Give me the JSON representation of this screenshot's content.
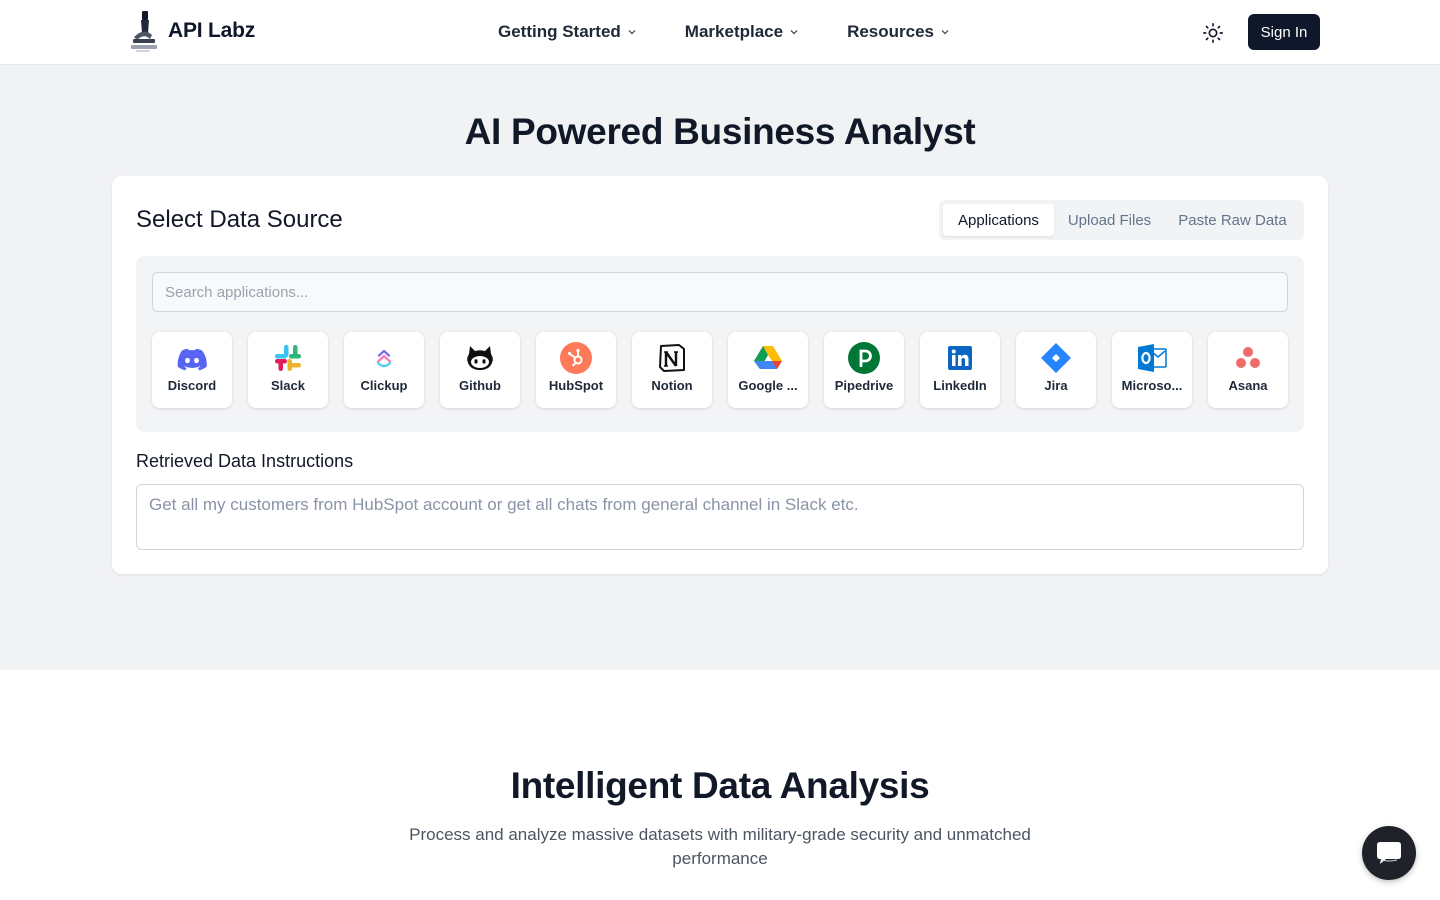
{
  "header": {
    "brand": "API Labz",
    "nav": [
      {
        "label": "Getting Started"
      },
      {
        "label": "Marketplace"
      },
      {
        "label": "Resources"
      }
    ],
    "theme_icon": "sun-icon",
    "sign_in": "Sign In"
  },
  "hero": {
    "title": "AI Powered Business Analyst",
    "card": {
      "title": "Select Data Source",
      "tabs": [
        {
          "label": "Applications",
          "active": true
        },
        {
          "label": "Upload Files",
          "active": false
        },
        {
          "label": "Paste Raw Data",
          "active": false
        }
      ],
      "search_placeholder": "Search applications...",
      "apps": [
        {
          "name": "Discord",
          "icon": "discord-icon"
        },
        {
          "name": "Slack",
          "icon": "slack-icon"
        },
        {
          "name": "Clickup",
          "icon": "clickup-icon"
        },
        {
          "name": "Github",
          "icon": "github-icon"
        },
        {
          "name": "HubSpot",
          "icon": "hubspot-icon"
        },
        {
          "name": "Notion",
          "icon": "notion-icon"
        },
        {
          "name": "Google ...",
          "icon": "google-drive-icon"
        },
        {
          "name": "Pipedrive",
          "icon": "pipedrive-icon"
        },
        {
          "name": "LinkedIn",
          "icon": "linkedin-icon"
        },
        {
          "name": "Jira",
          "icon": "jira-icon"
        },
        {
          "name": "Microso...",
          "icon": "microsoft-outlook-icon"
        },
        {
          "name": "Asana",
          "icon": "asana-icon"
        }
      ],
      "instructions_label": "Retrieved Data Instructions",
      "instructions_placeholder": "Get all my customers from HubSpot account or get all chats from general channel in Slack etc."
    }
  },
  "section2": {
    "title": "Intelligent Data Analysis",
    "subtitle": "Process and analyze massive datasets with military-grade security and unmatched performance"
  },
  "chat_icon": "chat-icon",
  "colors": {
    "primary": "#0f172a",
    "page_bg": "#f1f2f4",
    "hubspot": "#ff7a59",
    "pipedrive": "#017737",
    "linkedin": "#0a66c2",
    "jira": "#2684ff",
    "outlook": "#0078d4",
    "discord": "#5865f2",
    "asana": "#f06a6a"
  }
}
